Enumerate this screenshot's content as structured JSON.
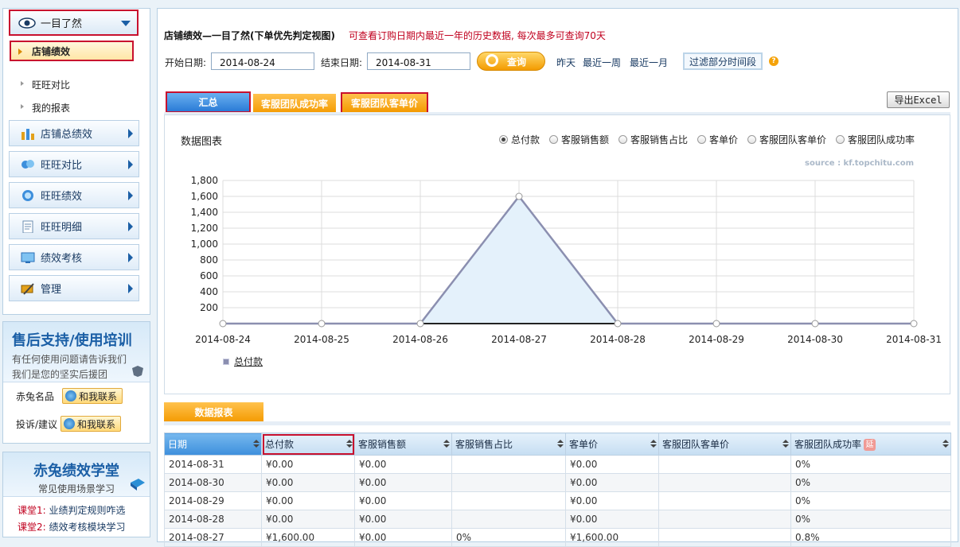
{
  "sidebar": {
    "top_label": "一目了然",
    "active_item": "店铺绩效",
    "sub_links": [
      "旺旺对比",
      "我的报表"
    ],
    "menu": [
      "店铺总绩效",
      "旺旺对比",
      "旺旺绩效",
      "旺旺明细",
      "绩效考核",
      "管理"
    ],
    "support": {
      "title": "售后支持/使用培训",
      "line1": "有任何使用问题请告诉我们",
      "line2": "我们是您的坚实后援团",
      "contacts": [
        {
          "label": "赤兔名品",
          "button": "和我联系"
        },
        {
          "label": "投诉/建议",
          "button": "和我联系"
        }
      ]
    },
    "academy": {
      "title": "赤兔绩效学堂",
      "subtitle": "常见使用场景学习",
      "lessons": [
        {
          "prefix": "课堂1:",
          "text": "业绩判定规则咋选"
        },
        {
          "prefix": "课堂2:",
          "text": "绩效考核模块学习"
        }
      ]
    }
  },
  "header": {
    "title": "店铺绩效—一目了然(下单优先判定视图)",
    "note": "可查看订购日期内最近一年的历史数据, 每次最多可查询70天",
    "start_label": "开始日期:",
    "start_value": "2014-08-24",
    "end_label": "结束日期:",
    "end_value": "2014-08-31",
    "query_label": "查询",
    "quick_links": [
      "昨天",
      "最近一周",
      "最近一月"
    ],
    "filter_label": "过滤部分时间段",
    "help_icon": "?"
  },
  "tabs": [
    "汇总",
    "客服团队成功率",
    "客服团队客单价"
  ],
  "export_label": "导出Excel",
  "chart_section": {
    "title": "数据图表",
    "radios": [
      "总付款",
      "客服销售额",
      "客服销售占比",
      "客单价",
      "客服团队客单价",
      "客服团队成功率"
    ],
    "selected_radio": 0,
    "source": "source : kf.topchitu.com"
  },
  "chart_data": {
    "type": "area",
    "x": [
      "2014-08-24",
      "2014-08-25",
      "2014-08-26",
      "2014-08-27",
      "2014-08-28",
      "2014-08-29",
      "2014-08-30",
      "2014-08-31"
    ],
    "series": [
      {
        "name": "总付款",
        "values": [
          0,
          0,
          0,
          1600,
          0,
          0,
          0,
          0
        ]
      }
    ],
    "yticks": [
      "200",
      "400",
      "600",
      "800",
      "1,000",
      "1,200",
      "1,400",
      "1,600",
      "1,800"
    ],
    "ylim": [
      0,
      1800
    ],
    "grid": true,
    "line_color": "#8b8fb0",
    "fill_color": "#e4f1fb"
  },
  "report": {
    "tab_label": "数据报表",
    "columns": [
      "日期",
      "总付款",
      "客服销售额",
      "客服销售占比",
      "客单价",
      "客服团队客单价",
      "客服团队成功率"
    ],
    "ext_badge": "延",
    "rows": [
      [
        "2014-08-31",
        "¥0.00",
        "¥0.00",
        "",
        "¥0.00",
        "",
        "0%"
      ],
      [
        "2014-08-30",
        "¥0.00",
        "¥0.00",
        "",
        "¥0.00",
        "",
        "0%"
      ],
      [
        "2014-08-29",
        "¥0.00",
        "¥0.00",
        "",
        "¥0.00",
        "",
        "0%"
      ],
      [
        "2014-08-28",
        "¥0.00",
        "¥0.00",
        "",
        "¥0.00",
        "",
        "0%"
      ],
      [
        "2014-08-27",
        "¥1,600.00",
        "¥0.00",
        "0%",
        "¥1,600.00",
        "",
        "0.8%"
      ]
    ]
  }
}
